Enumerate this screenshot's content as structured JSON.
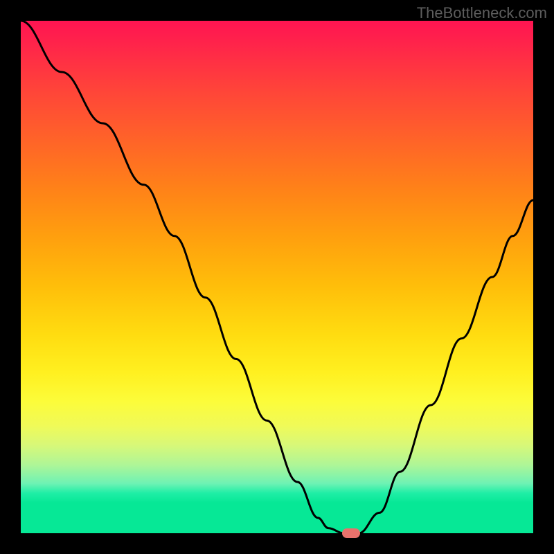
{
  "watermark": "TheBottleneck.com",
  "chart_data": {
    "type": "line",
    "title": "",
    "xlabel": "",
    "ylabel": "",
    "xlim": [
      0,
      100
    ],
    "ylim": [
      0,
      100
    ],
    "grid": false,
    "series": [
      {
        "name": "curve",
        "x": [
          0,
          8,
          16,
          24,
          30,
          36,
          42,
          48,
          54,
          58,
          60,
          63,
          66,
          70,
          74,
          80,
          86,
          92,
          96,
          100
        ],
        "values": [
          100,
          90,
          80,
          68,
          58,
          46,
          34,
          22,
          10,
          3,
          1,
          0,
          0,
          4,
          12,
          25,
          38,
          50,
          58,
          65
        ]
      }
    ],
    "marker": {
      "x": 64.5,
      "y": 0
    },
    "background_gradient": {
      "top": "#ff1452",
      "mid": "#ffdc10",
      "bottom": "#06e896"
    }
  }
}
